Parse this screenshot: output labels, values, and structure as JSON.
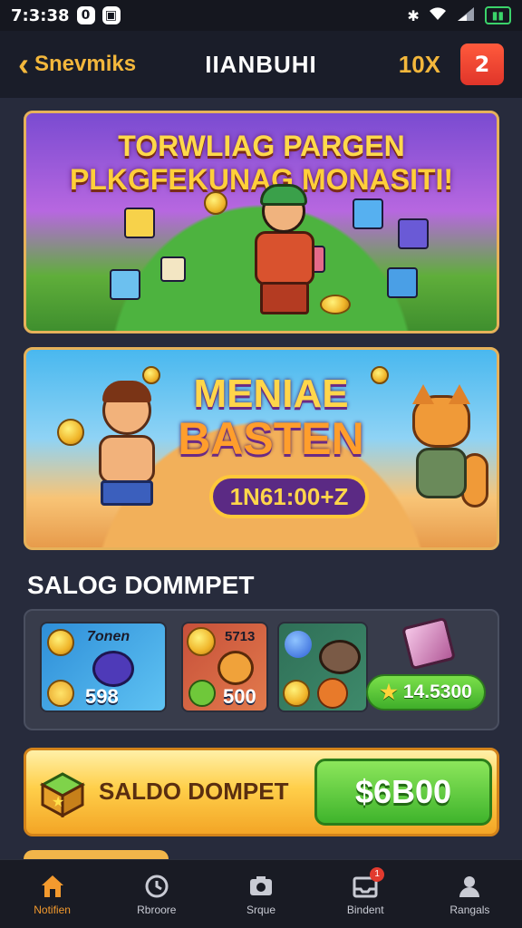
{
  "status_bar": {
    "time": "7:3:38",
    "badge": "0"
  },
  "header": {
    "back_label": "Snevmiks",
    "title": "IIANBUHI",
    "multiplier": "10X",
    "action_icon": "2"
  },
  "banners": [
    {
      "title_line1": "TORWLIAG PARGEN",
      "title_line2": "PLKGFEKUNAG MONASITI!"
    },
    {
      "title_line1": "MENIAE",
      "title_line2": "BASTEN",
      "pill_text": "1N61:00+Z"
    }
  ],
  "wallet_section": {
    "title": "SALOG DOMMPET",
    "cards": [
      {
        "label": "7onen",
        "value": "598"
      },
      {
        "label": "5713",
        "value": "500"
      },
      {
        "label": "",
        "value": ""
      }
    ],
    "balance": "14.5300"
  },
  "saldo": {
    "label": "SALDO DOMPET",
    "amount": "$6B00"
  },
  "bottom_nav": {
    "items": [
      {
        "label": "Notifien",
        "icon": "home-icon",
        "active": true
      },
      {
        "label": "Rbroore",
        "icon": "clock-icon",
        "active": false
      },
      {
        "label": "Srque",
        "icon": "camera-icon",
        "active": false
      },
      {
        "label": "Bindent",
        "icon": "inbox-icon",
        "active": false,
        "badge": "1"
      },
      {
        "label": "Rangals",
        "icon": "user-icon",
        "active": false
      }
    ]
  },
  "colors": {
    "accent": "#f3b73c",
    "active_nav": "#f39a2e",
    "green_button": "#3fb42c",
    "background": "#272b3c"
  }
}
